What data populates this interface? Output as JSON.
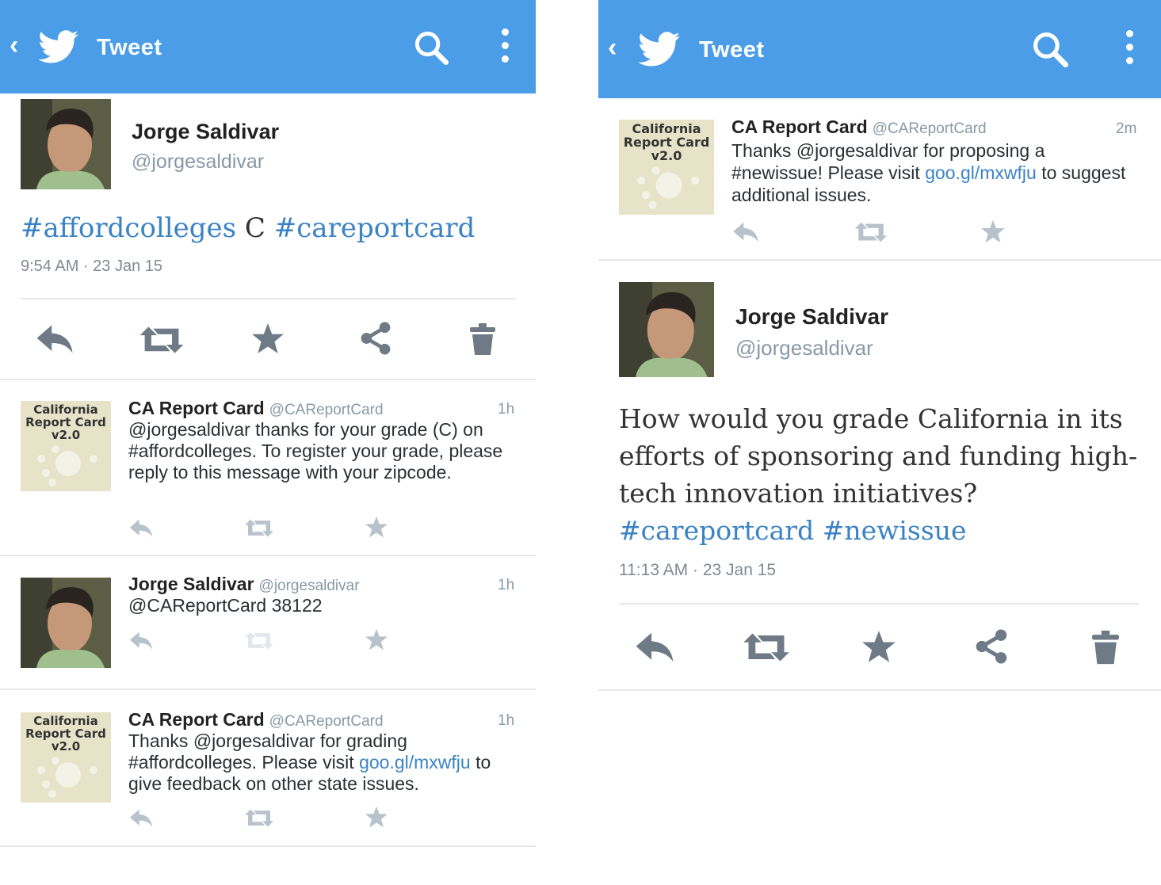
{
  "left": {
    "topbar": {
      "title": "Tweet"
    },
    "main_tweet": {
      "author_name": "Jorge Saldivar",
      "author_handle": "@jorgesaldivar",
      "text_parts": [
        "#affordcolleges",
        " C ",
        "#careportcard"
      ],
      "timestamp": "9:54 AM · 23 Jan 15"
    },
    "replies": [
      {
        "name": "CA Report Card",
        "handle": "@CAReportCard",
        "time": "1h",
        "text": "@jorgesaldivar thanks for your grade (C) on #affordcolleges. To register your grade, please reply to this message with your zipcode."
      },
      {
        "name": "Jorge Saldivar",
        "handle": "@jorgesaldivar",
        "time": "1h",
        "text": "@CAReportCard 38122"
      },
      {
        "name": "CA Report Card",
        "handle": "@CAReportCard",
        "time": "1h",
        "text_before": "Thanks @jorgesaldivar for grading #affordcolleges. Please visit ",
        "link": "goo.gl/mxwfju",
        "text_after": " to give feedback on other state issues."
      }
    ]
  },
  "right": {
    "topbar": {
      "title": "Tweet"
    },
    "parent_tweet": {
      "name": "CA Report Card",
      "handle": "@CAReportCard",
      "time": "2m",
      "text_before": "Thanks @jorgesaldivar for proposing a #newissue! Please visit ",
      "link": "goo.gl/mxwfju",
      "text_after": " to suggest additional issues."
    },
    "main_tweet": {
      "author_name": "Jorge Saldivar",
      "author_handle": "@jorgesaldivar",
      "text": "How would you grade California in its efforts of sponsoring and funding high-tech innovation initiatives?",
      "hashtag_1": "#careportcard",
      "hashtag_2": "#newissue",
      "timestamp": "11:13 AM · 23 Jan 15"
    }
  },
  "avatar_ca": {
    "line1": "California",
    "line2": "Report Card",
    "line3": "v2.0"
  },
  "colors": {
    "topbar": "#4a9de6",
    "link": "#3b83c4",
    "action_dark": "#6e7a85",
    "action_light": "#b8c2cb"
  },
  "icons": [
    "back-icon",
    "twitter-bird-icon",
    "search-icon",
    "more-icon",
    "reply-icon",
    "retweet-icon",
    "favorite-icon",
    "share-icon",
    "delete-icon"
  ]
}
